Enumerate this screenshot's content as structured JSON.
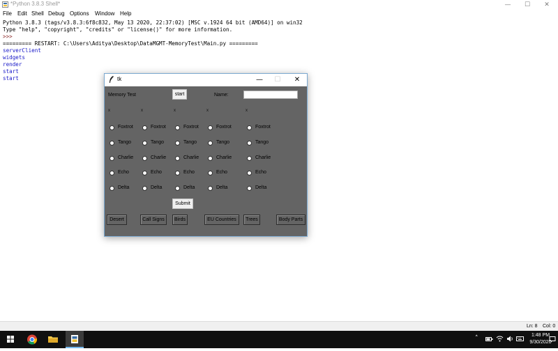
{
  "shell": {
    "title": "*Python 3.8.3 Shell*",
    "menus": [
      "File",
      "Edit",
      "Shell",
      "Debug",
      "Options",
      "Window",
      "Help"
    ],
    "lines": [
      {
        "text": "Python 3.8.3 (tags/v3.8.3:6f8c832, May 13 2020, 22:37:02) [MSC v.1924 64 bit (AMD64)] on win32",
        "kind": "plain"
      },
      {
        "text": "Type \"help\", \"copyright\", \"credits\" or \"license()\" for more information.",
        "kind": "plain"
      },
      {
        "text": ">>> ",
        "kind": "prompt"
      },
      {
        "text": "========= RESTART: C:\\Users\\Aditya\\Desktop\\DataMGMT-MemoryTest\\Main.py =========",
        "kind": "plain"
      },
      {
        "text": "serverClient",
        "kind": "out"
      },
      {
        "text": "widgets",
        "kind": "out"
      },
      {
        "text": "render",
        "kind": "out"
      },
      {
        "text": "start",
        "kind": "out"
      },
      {
        "text": "start",
        "kind": "out"
      }
    ],
    "status": {
      "line": "Ln: 8",
      "col": "Col: 0"
    }
  },
  "controls": {
    "minimize": "—",
    "maximize": "☐",
    "close": "✕"
  },
  "tk": {
    "title": "tk",
    "memory_test_label": "Memory Test",
    "start_button": "start",
    "name_label": "Name:",
    "name_value": "",
    "column_headers": [
      "x",
      "x",
      "x",
      "x",
      "x"
    ],
    "radio_options": [
      "Foxtrot",
      "Tango",
      "Charlie",
      "Echo",
      "Delta"
    ],
    "submit_button": "Submit",
    "categories": [
      "Desert",
      "Call Signs",
      "Birds",
      "EU Countries",
      "Trees",
      "Body Parts"
    ]
  },
  "taskbar": {
    "icons": [
      "windows-logo-icon",
      "chrome-icon",
      "file-explorer-icon",
      "idle-python-icon"
    ],
    "time": "1:48 PM",
    "date": "9/30/2020"
  }
}
